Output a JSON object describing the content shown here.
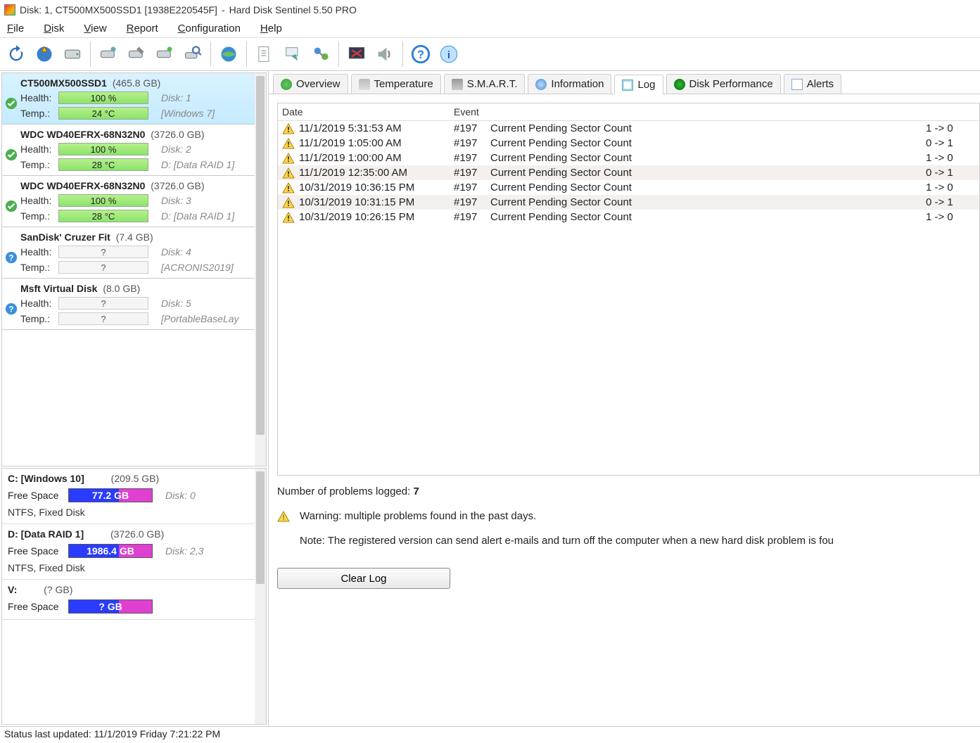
{
  "title": {
    "disk_label": "Disk: 1, CT500MX500SSD1 [1938E220545F]",
    "sep": " - ",
    "app": "Hard Disk Sentinel 5.50 PRO"
  },
  "menu": [
    "File",
    "Disk",
    "View",
    "Report",
    "Configuration",
    "Help"
  ],
  "tabs": [
    {
      "id": "overview",
      "label": "Overview",
      "icon": "green"
    },
    {
      "id": "temperature",
      "label": "Temperature",
      "icon": "therm"
    },
    {
      "id": "smart",
      "label": "S.M.A.R.T.",
      "icon": "drive"
    },
    {
      "id": "information",
      "label": "Information",
      "icon": "info"
    },
    {
      "id": "log",
      "label": "Log",
      "icon": "log",
      "active": true
    },
    {
      "id": "perf",
      "label": "Disk Performance",
      "icon": "perf"
    },
    {
      "id": "alerts",
      "label": "Alerts",
      "icon": "alert"
    }
  ],
  "disks": [
    {
      "name": "CT500MX500SSD1",
      "size": "(465.8 GB)",
      "health": "100 %",
      "temp": "24 °C",
      "diskno": "Disk: 1",
      "label": "[Windows 7]",
      "status": "ok",
      "selected": true
    },
    {
      "name": "WDC WD40EFRX-68N32N0",
      "size": "(3726.0 GB)",
      "health": "100 %",
      "temp": "28 °C",
      "diskno": "Disk: 2",
      "label": "D: [Data RAID 1]",
      "status": "ok"
    },
    {
      "name": "WDC WD40EFRX-68N32N0",
      "size": "(3726.0 GB)",
      "health": "100 %",
      "temp": "28 °C",
      "diskno": "Disk: 3",
      "label": "D: [Data RAID 1]",
      "status": "ok"
    },
    {
      "name": "SanDisk' Cruzer Fit",
      "size": "(7.4 GB)",
      "health": "?",
      "temp": "?",
      "diskno": "Disk: 4",
      "label": "[ACRONIS2019]",
      "status": "unknown"
    },
    {
      "name": "Msft    Virtual Disk",
      "size": "(8.0 GB)",
      "health": "?",
      "temp": "?",
      "diskno": "Disk: 5",
      "label": "[PortableBaseLay",
      "status": "unknown"
    }
  ],
  "partitions": [
    {
      "letter": "C:",
      "name": "[Windows 10]",
      "size": "(209.5 GB)",
      "free": "77.2 GB",
      "diskno": "Disk: 0",
      "fmt": "NTFS, Fixed Disk"
    },
    {
      "letter": "D:",
      "name": "[Data RAID 1]",
      "size": "(3726.0 GB)",
      "free": "1986.4 GB",
      "diskno": "Disk: 2,3",
      "fmt": "NTFS, Fixed Disk"
    },
    {
      "letter": "V:",
      "name": "",
      "size": "(? GB)",
      "free": "? GB",
      "diskno": "",
      "fmt": ""
    }
  ],
  "log": {
    "headers": {
      "date": "Date",
      "event": "Event"
    },
    "rows": [
      {
        "date": "11/1/2019 5:31:53 AM",
        "id": "#197",
        "event": "Current Pending Sector Count",
        "change": "1 -> 0"
      },
      {
        "date": "11/1/2019 1:05:00 AM",
        "id": "#197",
        "event": "Current Pending Sector Count",
        "change": "0 -> 1"
      },
      {
        "date": "11/1/2019 1:00:00 AM",
        "id": "#197",
        "event": "Current Pending Sector Count",
        "change": "1 -> 0"
      },
      {
        "date": "11/1/2019 12:35:00 AM",
        "id": "#197",
        "event": "Current Pending Sector Count",
        "change": "0 -> 1",
        "alt": true
      },
      {
        "date": "10/31/2019 10:36:15 PM",
        "id": "#197",
        "event": "Current Pending Sector Count",
        "change": "1 -> 0"
      },
      {
        "date": "10/31/2019 10:31:15 PM",
        "id": "#197",
        "event": "Current Pending Sector Count",
        "change": "0 -> 1",
        "alt": true
      },
      {
        "date": "10/31/2019 10:26:15 PM",
        "id": "#197",
        "event": "Current Pending Sector Count",
        "change": "1 -> 0"
      }
    ],
    "summary_label": "Number of problems logged: ",
    "summary_count": "7",
    "warning": "Warning: multiple problems found in the past days.",
    "note": "Note: The registered version can send alert e-mails and turn off the computer when a new hard disk problem is fou",
    "clear": "Clear Log"
  },
  "labels": {
    "health": "Health:",
    "temp": "Temp.:",
    "freespace": "Free Space"
  },
  "status": "Status last updated: 11/1/2019 Friday 7:21:22 PM"
}
